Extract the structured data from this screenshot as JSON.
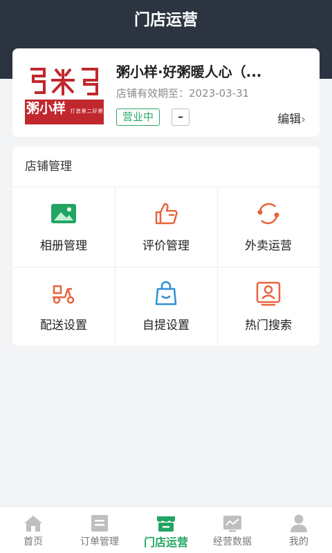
{
  "header": {
    "title": "门店运营"
  },
  "store": {
    "logo_text": "粥小样",
    "logo_mark": "ᕮ米ᑫ",
    "logo_banner": "粥小样",
    "logo_slogan": "打造第二好粥",
    "name": "粥小样·好粥暖人心（...",
    "validity": "店铺有效期至：2023-03-31",
    "status": "营业中",
    "dash": "–",
    "edit_label": "编辑",
    "edit_chevron": "›"
  },
  "manage": {
    "title": "店铺管理",
    "items": [
      {
        "label": "相册管理",
        "icon": "album-icon",
        "color": "#22a562"
      },
      {
        "label": "评价管理",
        "icon": "thumbs-up-icon",
        "color": "#e8623a"
      },
      {
        "label": "外卖运营",
        "icon": "refresh-icon",
        "color": "#e8623a"
      },
      {
        "label": "配送设置",
        "icon": "scooter-icon",
        "color": "#e8623a"
      },
      {
        "label": "自提设置",
        "icon": "shopping-bag-icon",
        "color": "#2a8fd6"
      },
      {
        "label": "热门搜索",
        "icon": "search-person-icon",
        "color": "#e8623a"
      }
    ]
  },
  "tabbar": {
    "items": [
      {
        "label": "首页",
        "icon": "home-icon",
        "active": false
      },
      {
        "label": "订单管理",
        "icon": "orders-icon",
        "active": false
      },
      {
        "label": "门店运营",
        "icon": "store-icon",
        "active": true
      },
      {
        "label": "经营数据",
        "icon": "chart-icon",
        "active": false
      },
      {
        "label": "我的",
        "icon": "user-icon",
        "active": false
      }
    ]
  },
  "colors": {
    "header": "#2b3440",
    "accent": "#22a562",
    "inactive": "#bfbfbf"
  }
}
